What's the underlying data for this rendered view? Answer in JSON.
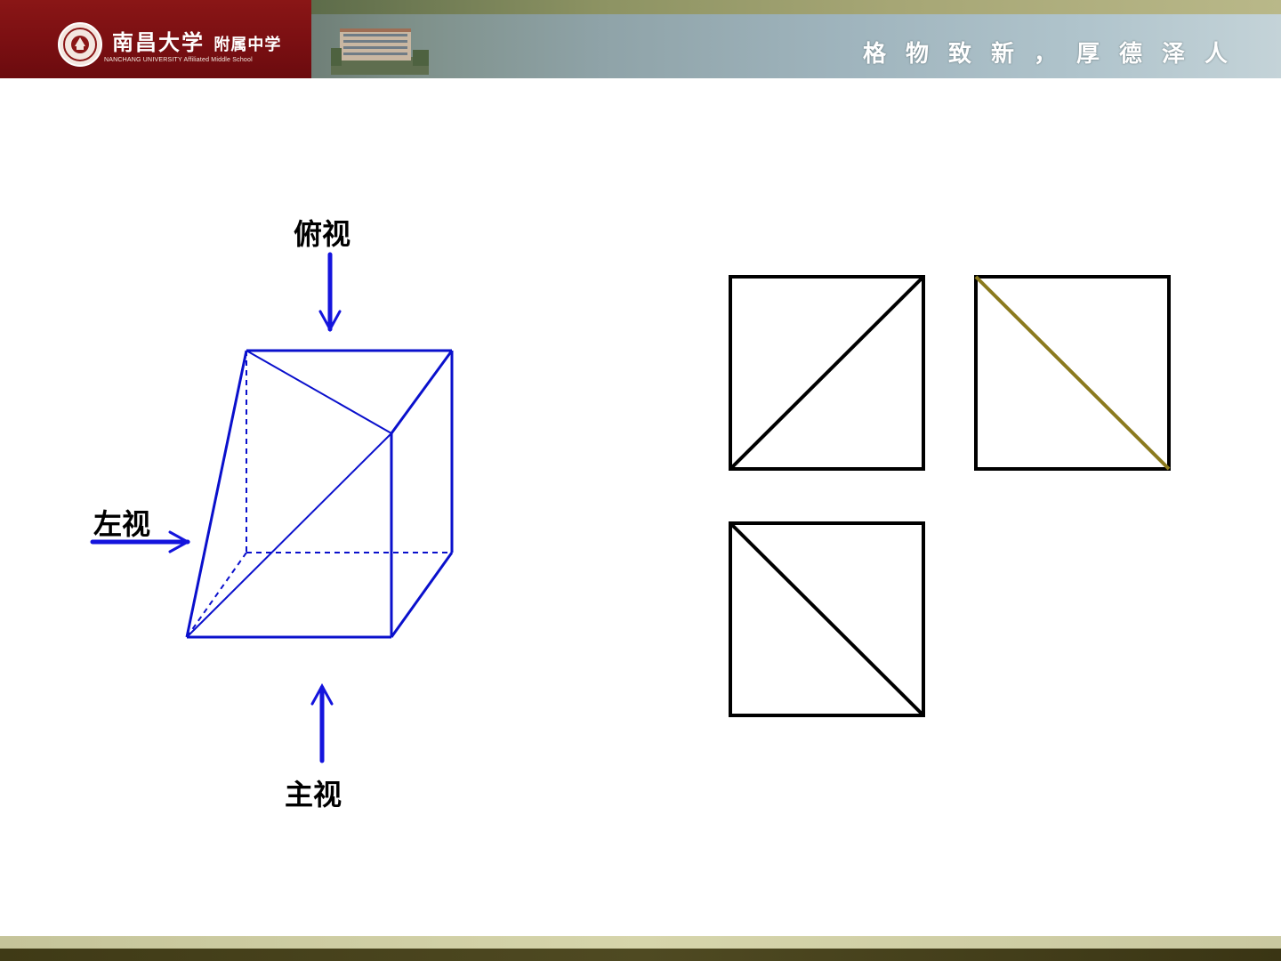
{
  "header": {
    "school_name_cn": "南昌大学",
    "school_subname_cn": "附属中学",
    "school_name_en": "NANCHANG UNIVERSITY Affiliated Middle School",
    "motto": "格物致新，厚德泽人",
    "logo_icon": "school-seal-icon",
    "photo_icon": "campus-building-photo"
  },
  "diagram": {
    "labels": {
      "top_view": "俯视",
      "left_view": "左视",
      "front_view": "主视"
    },
    "colors": {
      "solid": "#0a10cc",
      "arrow": "#1414dd",
      "views": "#000000",
      "highlight_diagonal": "#8b7a1e"
    },
    "views": [
      {
        "name": "front-view",
        "diagonal": "bottom-left-to-top-right"
      },
      {
        "name": "left-view",
        "diagonal": "top-left-to-bottom-right",
        "diagonal_color": "#8b7a1e"
      },
      {
        "name": "top-view",
        "diagonal": "top-left-to-bottom-right"
      }
    ]
  },
  "colors": {
    "banner_left": "#7a0f12",
    "banner_right": "#b0c4cc",
    "footer_light": "#d6d5ab",
    "footer_dark": "#4f4a22"
  }
}
